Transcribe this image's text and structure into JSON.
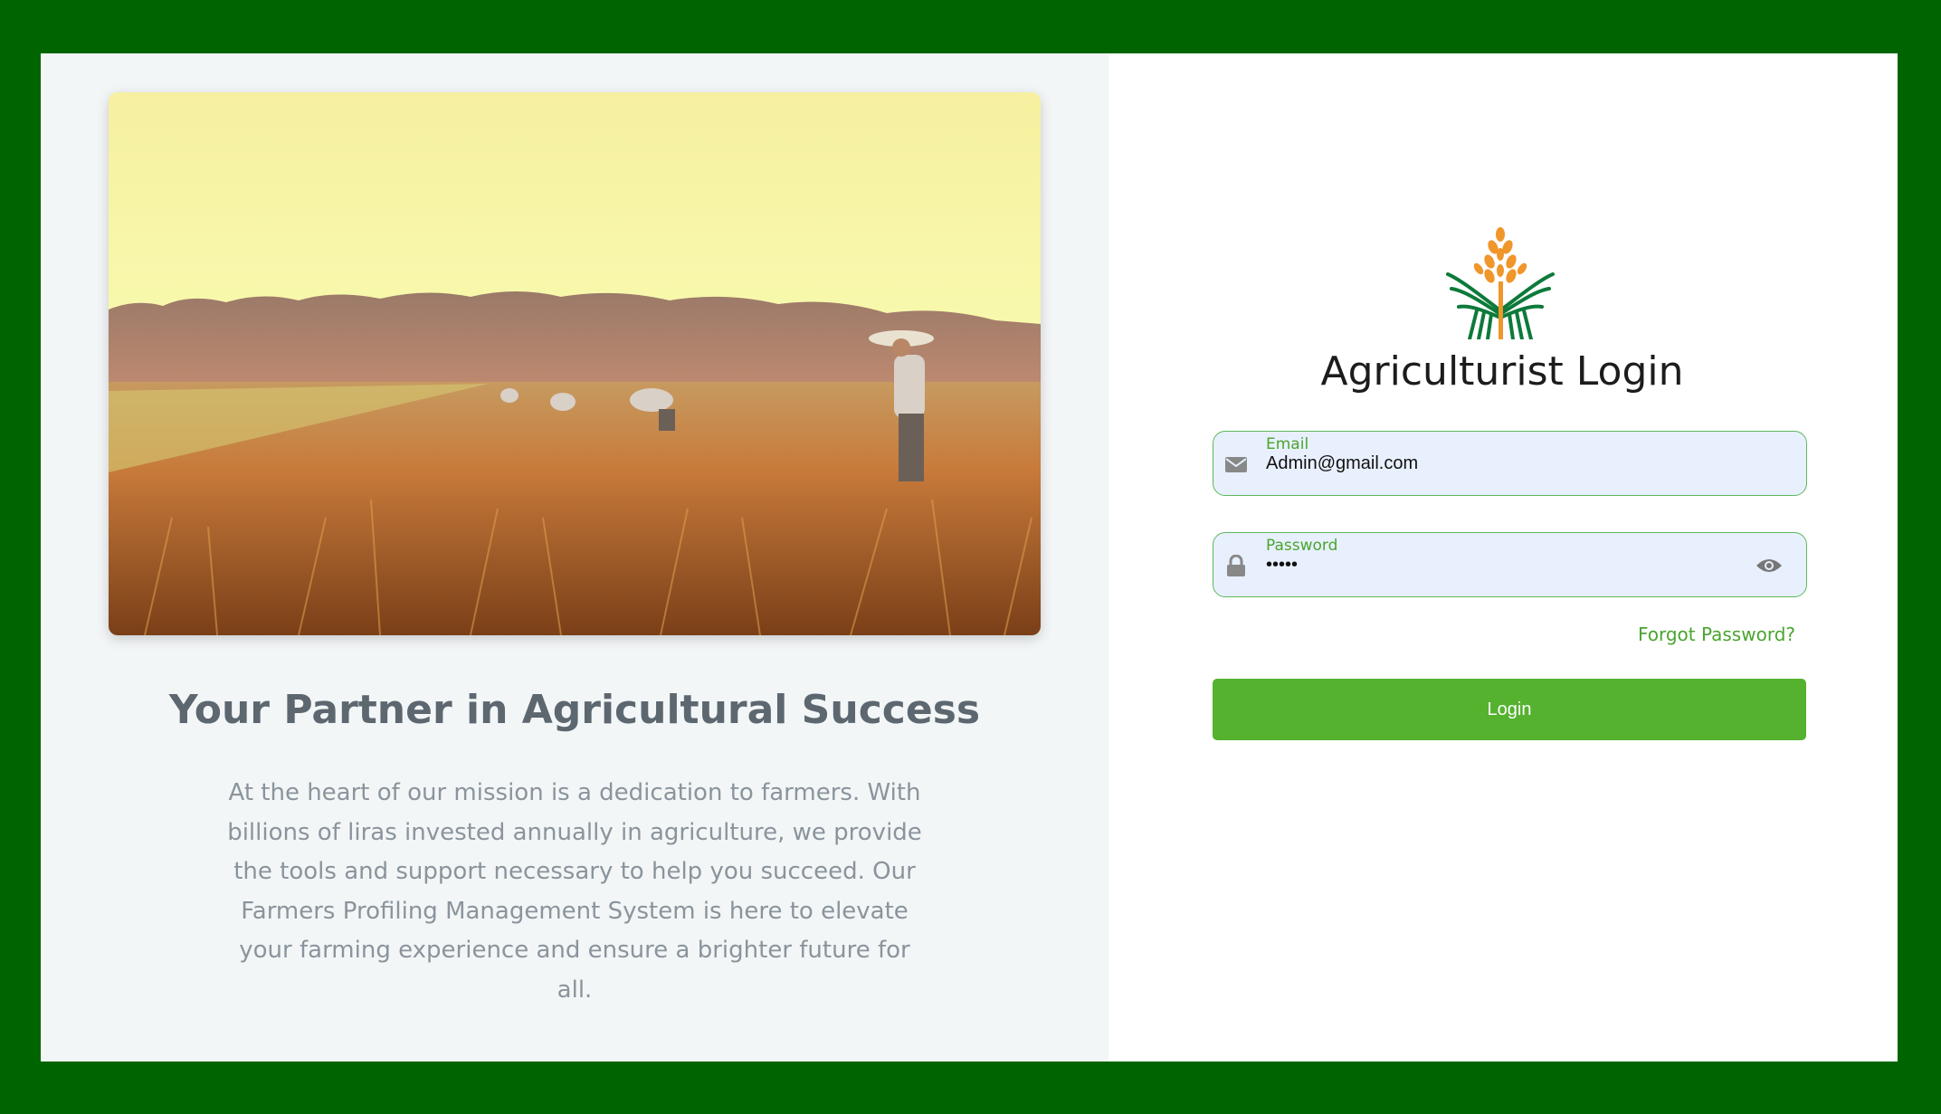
{
  "colors": {
    "frame": "#006400",
    "accent_green": "#55b22f",
    "label_green": "#4aa52e",
    "input_bg": "#e8f0fe",
    "left_panel_bg": "#f3f6f7"
  },
  "left": {
    "hero_image": "farmers-harvesting-rice-field",
    "tagline": "Your Partner in Agricultural Success",
    "description": "At the heart of our mission is a dedication to farmers. With billions of liras invested annually in agriculture, we provide the tools and support necessary to help you succeed. Our Farmers Profiling Management System is here to elevate your farming experience and ensure a brighter future for all."
  },
  "login": {
    "logo": "wheat-logo",
    "title": "Agriculturist Login",
    "email": {
      "label": "Email",
      "value": "Admin@gmail.com",
      "icon": "envelope-icon"
    },
    "password": {
      "label": "Password",
      "value": "•••••",
      "icon": "lock-icon",
      "toggle_icon": "eye-icon"
    },
    "forgot_label": "Forgot Password?",
    "login_button": "Login"
  }
}
